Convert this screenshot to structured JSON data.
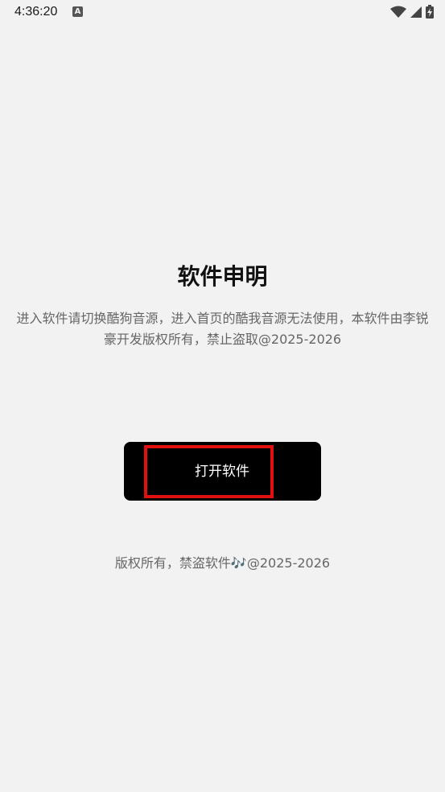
{
  "status_bar": {
    "time": "4:36:20",
    "notification_icon_letter": "A",
    "icons": [
      "wifi-icon",
      "signal-icon",
      "battery-icon"
    ]
  },
  "main": {
    "title": "软件申明",
    "description_lines": [
      "进入软件请切换酷狗音源，进入首页的酷我音源无法使用，本软件由李锐",
      "豪开发版权所有，禁止盗取@2025-2026"
    ],
    "open_button_label": "打开软件",
    "footer": "版权所有，禁盗软件🎶@2025-2026"
  },
  "colors": {
    "background": "#f2f2f2",
    "button": "#000000",
    "highlight": "#e01010"
  }
}
